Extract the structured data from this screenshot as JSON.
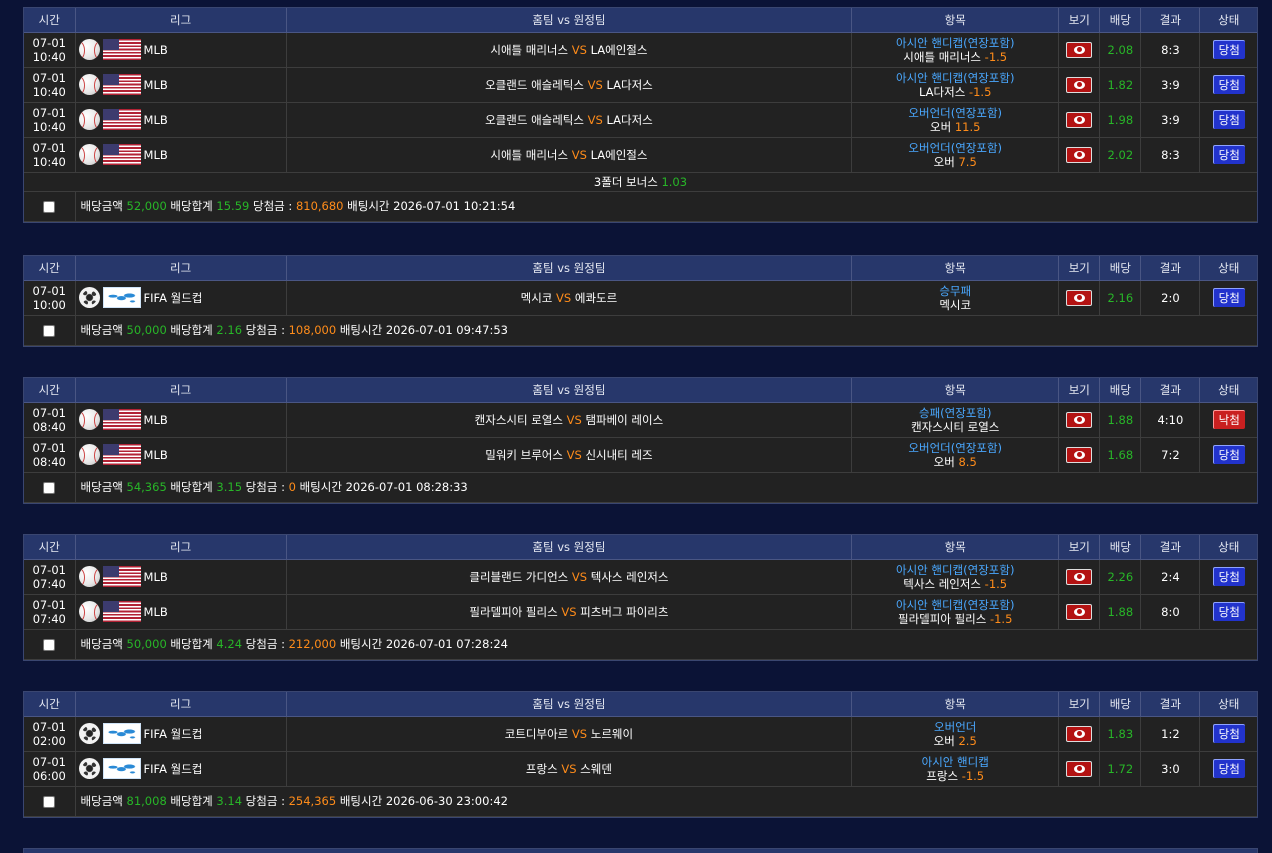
{
  "headers": {
    "time": "시간",
    "league": "리그",
    "teams": "홈팀 vs 원정팀",
    "item": "항목",
    "view": "보기",
    "odds": "배당",
    "result": "결과",
    "status": "상태"
  },
  "vs_label": "VS",
  "labels": {
    "amount": "배당금액",
    "total_odds": "배당합계",
    "winnings": "당첨금 :",
    "bet_time": "배팅시간"
  },
  "bets": [
    {
      "rows": [
        {
          "date": "07-01",
          "time": "10:40",
          "sport_icon": "baseball-icon",
          "flag": "us-flag-icon",
          "league": "MLB",
          "home": "시애틀 매리너스",
          "away": "LA에인절스",
          "market": "아시안 핸디캡(연장포함)",
          "pick": "시애틀 매리너스",
          "line": "-1.5",
          "odds": "2.08",
          "result": "8:3",
          "status": "당첨",
          "status_type": "win"
        },
        {
          "date": "07-01",
          "time": "10:40",
          "sport_icon": "baseball-icon",
          "flag": "us-flag-icon",
          "league": "MLB",
          "home": "오클랜드 애슬레틱스",
          "away": "LA다저스",
          "market": "아시안 핸디캡(연장포함)",
          "pick": "LA다저스",
          "line": "-1.5",
          "odds": "1.82",
          "result": "3:9",
          "status": "당첨",
          "status_type": "win"
        },
        {
          "date": "07-01",
          "time": "10:40",
          "sport_icon": "baseball-icon",
          "flag": "us-flag-icon",
          "league": "MLB",
          "home": "오클랜드 애슬레틱스",
          "away": "LA다저스",
          "market": "오버언더(연장포함)",
          "pick": "오버",
          "line": "11.5",
          "odds": "1.98",
          "result": "3:9",
          "status": "당첨",
          "status_type": "win"
        },
        {
          "date": "07-01",
          "time": "10:40",
          "sport_icon": "baseball-icon",
          "flag": "us-flag-icon",
          "league": "MLB",
          "home": "시애틀 매리너스",
          "away": "LA에인절스",
          "market": "오버언더(연장포함)",
          "pick": "오버",
          "line": "7.5",
          "odds": "2.02",
          "result": "8:3",
          "status": "당첨",
          "status_type": "win"
        }
      ],
      "bonus_label": "3폴더 보너스",
      "bonus_value": "1.03",
      "amount": "52,000",
      "total_odds": "15.59",
      "winnings": "810,680",
      "bet_time": "2026-07-01 10:21:54"
    },
    {
      "rows": [
        {
          "date": "07-01",
          "time": "10:00",
          "sport_icon": "soccer-ball-icon",
          "flag": "world-flag-icon",
          "league": "FIFA 월드컵",
          "home": "멕시코",
          "away": "에콰도르",
          "market": "승무패",
          "pick": "멕시코",
          "line": "",
          "odds": "2.16",
          "result": "2:0",
          "status": "당첨",
          "status_type": "win"
        }
      ],
      "amount": "50,000",
      "total_odds": "2.16",
      "winnings": "108,000",
      "bet_time": "2026-07-01 09:47:53"
    },
    {
      "rows": [
        {
          "date": "07-01",
          "time": "08:40",
          "sport_icon": "baseball-icon",
          "flag": "us-flag-icon",
          "league": "MLB",
          "home": "캔자스시티 로열스",
          "away": "탬파베이 레이스",
          "market": "승패(연장포함)",
          "pick": "캔자스시티 로열스",
          "line": "",
          "odds": "1.88",
          "result": "4:10",
          "status": "낙첨",
          "status_type": "lose"
        },
        {
          "date": "07-01",
          "time": "08:40",
          "sport_icon": "baseball-icon",
          "flag": "us-flag-icon",
          "league": "MLB",
          "home": "밀워키 브루어스",
          "away": "신시내티 레즈",
          "market": "오버언더(연장포함)",
          "pick": "오버",
          "line": "8.5",
          "odds": "1.68",
          "result": "7:2",
          "status": "당첨",
          "status_type": "win"
        }
      ],
      "amount": "54,365",
      "total_odds": "3.15",
      "winnings": "0",
      "bet_time": "2026-07-01 08:28:33"
    },
    {
      "rows": [
        {
          "date": "07-01",
          "time": "07:40",
          "sport_icon": "baseball-icon",
          "flag": "us-flag-icon",
          "league": "MLB",
          "home": "클리블랜드 가디언스",
          "away": "텍사스 레인저스",
          "market": "아시안 핸디캡(연장포함)",
          "pick": "텍사스 레인저스",
          "line": "-1.5",
          "odds": "2.26",
          "result": "2:4",
          "status": "당첨",
          "status_type": "win"
        },
        {
          "date": "07-01",
          "time": "07:40",
          "sport_icon": "baseball-icon",
          "flag": "us-flag-icon",
          "league": "MLB",
          "home": "필라델피아 필리스",
          "away": "피츠버그 파이리츠",
          "market": "아시안 핸디캡(연장포함)",
          "pick": "필라델피아 필리스",
          "line": "-1.5",
          "odds": "1.88",
          "result": "8:0",
          "status": "당첨",
          "status_type": "win"
        }
      ],
      "amount": "50,000",
      "total_odds": "4.24",
      "winnings": "212,000",
      "bet_time": "2026-07-01 07:28:24"
    },
    {
      "rows": [
        {
          "date": "07-01",
          "time": "02:00",
          "sport_icon": "soccer-ball-icon",
          "flag": "world-flag-icon",
          "league": "FIFA 월드컵",
          "home": "코트디부아르",
          "away": "노르웨이",
          "market": "오버언더",
          "pick": "오버",
          "line": "2.5",
          "odds": "1.83",
          "result": "1:2",
          "status": "당첨",
          "status_type": "win"
        },
        {
          "date": "07-01",
          "time": "06:00",
          "sport_icon": "soccer-ball-icon",
          "flag": "world-flag-icon",
          "league": "FIFA 월드컵",
          "home": "프랑스",
          "away": "스웨덴",
          "market": "아시안 핸디캡",
          "pick": "프랑스",
          "line": "-1.5",
          "odds": "1.72",
          "result": "3:0",
          "status": "당첨",
          "status_type": "win"
        }
      ],
      "amount": "81,008",
      "total_odds": "3.14",
      "winnings": "254,365",
      "bet_time": "2026-06-30 23:00:42"
    }
  ],
  "colors": {
    "page_bg": "#0b1336",
    "header_bg": "#27376b",
    "row_bg": "#222222",
    "accent_orange": "#ff8c1a",
    "accent_blue": "#4aa8ff",
    "accent_green": "#28b628",
    "win_badge": "#2233cc",
    "lose_badge": "#c92020"
  }
}
